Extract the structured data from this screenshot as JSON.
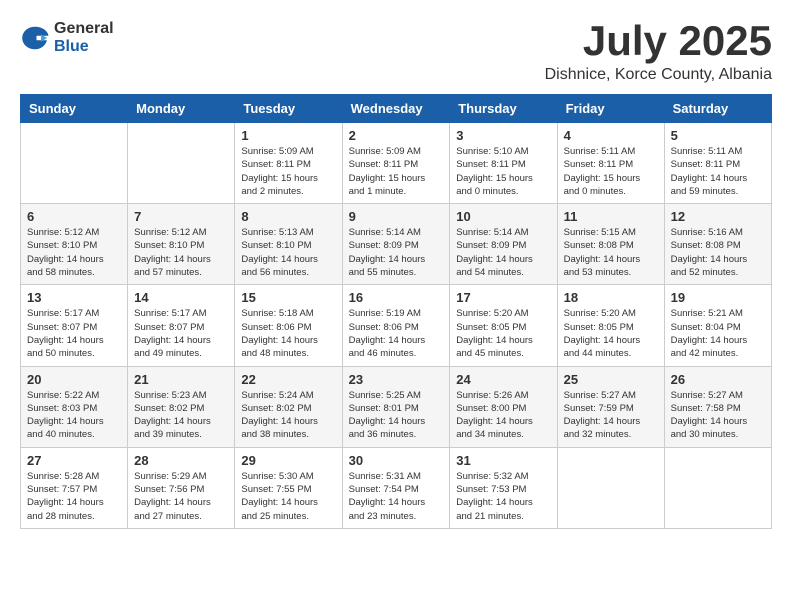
{
  "logo": {
    "general": "General",
    "blue": "Blue"
  },
  "title": {
    "month": "July 2025",
    "location": "Dishnice, Korce County, Albania"
  },
  "weekdays": [
    "Sunday",
    "Monday",
    "Tuesday",
    "Wednesday",
    "Thursday",
    "Friday",
    "Saturday"
  ],
  "weeks": [
    [
      {
        "day": "",
        "sunrise": "",
        "sunset": "",
        "daylight": ""
      },
      {
        "day": "",
        "sunrise": "",
        "sunset": "",
        "daylight": ""
      },
      {
        "day": "1",
        "sunrise": "Sunrise: 5:09 AM",
        "sunset": "Sunset: 8:11 PM",
        "daylight": "Daylight: 15 hours and 2 minutes."
      },
      {
        "day": "2",
        "sunrise": "Sunrise: 5:09 AM",
        "sunset": "Sunset: 8:11 PM",
        "daylight": "Daylight: 15 hours and 1 minute."
      },
      {
        "day": "3",
        "sunrise": "Sunrise: 5:10 AM",
        "sunset": "Sunset: 8:11 PM",
        "daylight": "Daylight: 15 hours and 0 minutes."
      },
      {
        "day": "4",
        "sunrise": "Sunrise: 5:11 AM",
        "sunset": "Sunset: 8:11 PM",
        "daylight": "Daylight: 15 hours and 0 minutes."
      },
      {
        "day": "5",
        "sunrise": "Sunrise: 5:11 AM",
        "sunset": "Sunset: 8:11 PM",
        "daylight": "Daylight: 14 hours and 59 minutes."
      }
    ],
    [
      {
        "day": "6",
        "sunrise": "Sunrise: 5:12 AM",
        "sunset": "Sunset: 8:10 PM",
        "daylight": "Daylight: 14 hours and 58 minutes."
      },
      {
        "day": "7",
        "sunrise": "Sunrise: 5:12 AM",
        "sunset": "Sunset: 8:10 PM",
        "daylight": "Daylight: 14 hours and 57 minutes."
      },
      {
        "day": "8",
        "sunrise": "Sunrise: 5:13 AM",
        "sunset": "Sunset: 8:10 PM",
        "daylight": "Daylight: 14 hours and 56 minutes."
      },
      {
        "day": "9",
        "sunrise": "Sunrise: 5:14 AM",
        "sunset": "Sunset: 8:09 PM",
        "daylight": "Daylight: 14 hours and 55 minutes."
      },
      {
        "day": "10",
        "sunrise": "Sunrise: 5:14 AM",
        "sunset": "Sunset: 8:09 PM",
        "daylight": "Daylight: 14 hours and 54 minutes."
      },
      {
        "day": "11",
        "sunrise": "Sunrise: 5:15 AM",
        "sunset": "Sunset: 8:08 PM",
        "daylight": "Daylight: 14 hours and 53 minutes."
      },
      {
        "day": "12",
        "sunrise": "Sunrise: 5:16 AM",
        "sunset": "Sunset: 8:08 PM",
        "daylight": "Daylight: 14 hours and 52 minutes."
      }
    ],
    [
      {
        "day": "13",
        "sunrise": "Sunrise: 5:17 AM",
        "sunset": "Sunset: 8:07 PM",
        "daylight": "Daylight: 14 hours and 50 minutes."
      },
      {
        "day": "14",
        "sunrise": "Sunrise: 5:17 AM",
        "sunset": "Sunset: 8:07 PM",
        "daylight": "Daylight: 14 hours and 49 minutes."
      },
      {
        "day": "15",
        "sunrise": "Sunrise: 5:18 AM",
        "sunset": "Sunset: 8:06 PM",
        "daylight": "Daylight: 14 hours and 48 minutes."
      },
      {
        "day": "16",
        "sunrise": "Sunrise: 5:19 AM",
        "sunset": "Sunset: 8:06 PM",
        "daylight": "Daylight: 14 hours and 46 minutes."
      },
      {
        "day": "17",
        "sunrise": "Sunrise: 5:20 AM",
        "sunset": "Sunset: 8:05 PM",
        "daylight": "Daylight: 14 hours and 45 minutes."
      },
      {
        "day": "18",
        "sunrise": "Sunrise: 5:20 AM",
        "sunset": "Sunset: 8:05 PM",
        "daylight": "Daylight: 14 hours and 44 minutes."
      },
      {
        "day": "19",
        "sunrise": "Sunrise: 5:21 AM",
        "sunset": "Sunset: 8:04 PM",
        "daylight": "Daylight: 14 hours and 42 minutes."
      }
    ],
    [
      {
        "day": "20",
        "sunrise": "Sunrise: 5:22 AM",
        "sunset": "Sunset: 8:03 PM",
        "daylight": "Daylight: 14 hours and 40 minutes."
      },
      {
        "day": "21",
        "sunrise": "Sunrise: 5:23 AM",
        "sunset": "Sunset: 8:02 PM",
        "daylight": "Daylight: 14 hours and 39 minutes."
      },
      {
        "day": "22",
        "sunrise": "Sunrise: 5:24 AM",
        "sunset": "Sunset: 8:02 PM",
        "daylight": "Daylight: 14 hours and 38 minutes."
      },
      {
        "day": "23",
        "sunrise": "Sunrise: 5:25 AM",
        "sunset": "Sunset: 8:01 PM",
        "daylight": "Daylight: 14 hours and 36 minutes."
      },
      {
        "day": "24",
        "sunrise": "Sunrise: 5:26 AM",
        "sunset": "Sunset: 8:00 PM",
        "daylight": "Daylight: 14 hours and 34 minutes."
      },
      {
        "day": "25",
        "sunrise": "Sunrise: 5:27 AM",
        "sunset": "Sunset: 7:59 PM",
        "daylight": "Daylight: 14 hours and 32 minutes."
      },
      {
        "day": "26",
        "sunrise": "Sunrise: 5:27 AM",
        "sunset": "Sunset: 7:58 PM",
        "daylight": "Daylight: 14 hours and 30 minutes."
      }
    ],
    [
      {
        "day": "27",
        "sunrise": "Sunrise: 5:28 AM",
        "sunset": "Sunset: 7:57 PM",
        "daylight": "Daylight: 14 hours and 28 minutes."
      },
      {
        "day": "28",
        "sunrise": "Sunrise: 5:29 AM",
        "sunset": "Sunset: 7:56 PM",
        "daylight": "Daylight: 14 hours and 27 minutes."
      },
      {
        "day": "29",
        "sunrise": "Sunrise: 5:30 AM",
        "sunset": "Sunset: 7:55 PM",
        "daylight": "Daylight: 14 hours and 25 minutes."
      },
      {
        "day": "30",
        "sunrise": "Sunrise: 5:31 AM",
        "sunset": "Sunset: 7:54 PM",
        "daylight": "Daylight: 14 hours and 23 minutes."
      },
      {
        "day": "31",
        "sunrise": "Sunrise: 5:32 AM",
        "sunset": "Sunset: 7:53 PM",
        "daylight": "Daylight: 14 hours and 21 minutes."
      },
      {
        "day": "",
        "sunrise": "",
        "sunset": "",
        "daylight": ""
      },
      {
        "day": "",
        "sunrise": "",
        "sunset": "",
        "daylight": ""
      }
    ]
  ]
}
